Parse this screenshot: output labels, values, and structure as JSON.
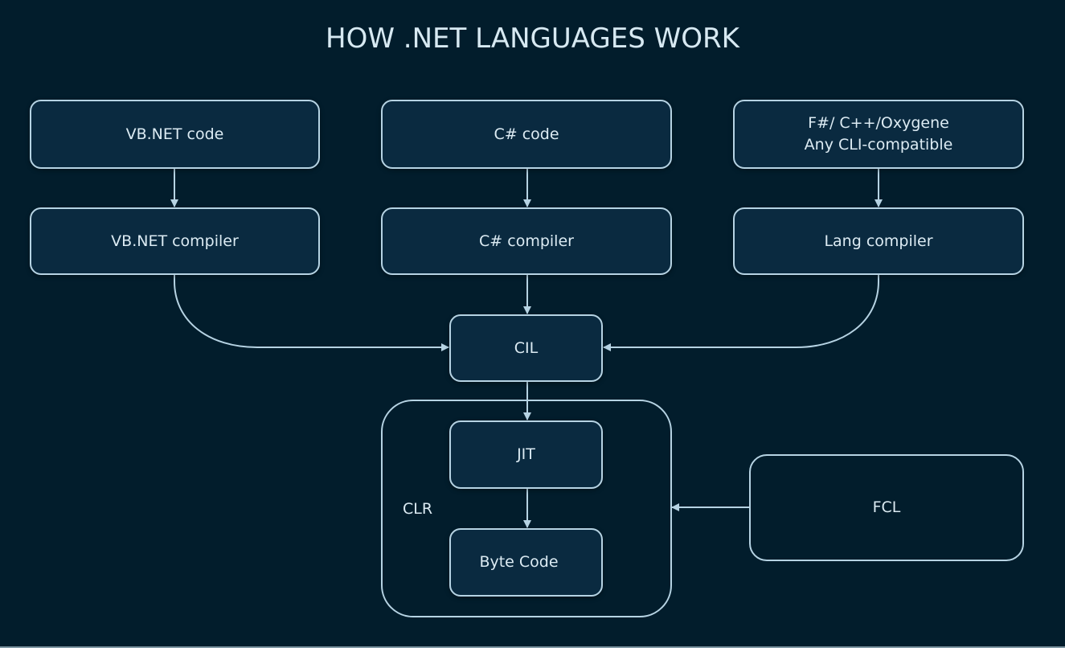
{
  "title": "HOW .NET LANGUAGES WORK",
  "colors": {
    "background": "#021d2c",
    "box_fill": "#0a2a40",
    "stroke": "#b6d3e3",
    "text": "#dcebf3"
  },
  "nodes": {
    "vbnet_code": {
      "label": "VB.NET code"
    },
    "csharp_code": {
      "label": "C# code"
    },
    "other_code": {
      "line1": "F#/ C++/Oxygene",
      "line2": "Any CLI-compatible"
    },
    "vbnet_compiler": {
      "label": "VB.NET compiler"
    },
    "csharp_compiler": {
      "label": "C# compiler"
    },
    "lang_compiler": {
      "label": "Lang compiler"
    },
    "cil": {
      "label": "CIL"
    },
    "clr": {
      "label": "CLR"
    },
    "jit": {
      "label": "JIT"
    },
    "byte_code": {
      "label": "Byte Code"
    },
    "fcl": {
      "label": "FCL"
    }
  },
  "edges": [
    {
      "from": "VB.NET code",
      "to": "VB.NET compiler"
    },
    {
      "from": "C# code",
      "to": "C# compiler"
    },
    {
      "from": "F#/ C++/Oxygene Any CLI-compatible",
      "to": "Lang compiler"
    },
    {
      "from": "VB.NET compiler",
      "to": "CIL"
    },
    {
      "from": "C# compiler",
      "to": "CIL"
    },
    {
      "from": "Lang compiler",
      "to": "CIL"
    },
    {
      "from": "CIL",
      "to": "JIT"
    },
    {
      "from": "JIT",
      "to": "Byte Code"
    },
    {
      "from": "FCL",
      "to": "CLR"
    }
  ]
}
